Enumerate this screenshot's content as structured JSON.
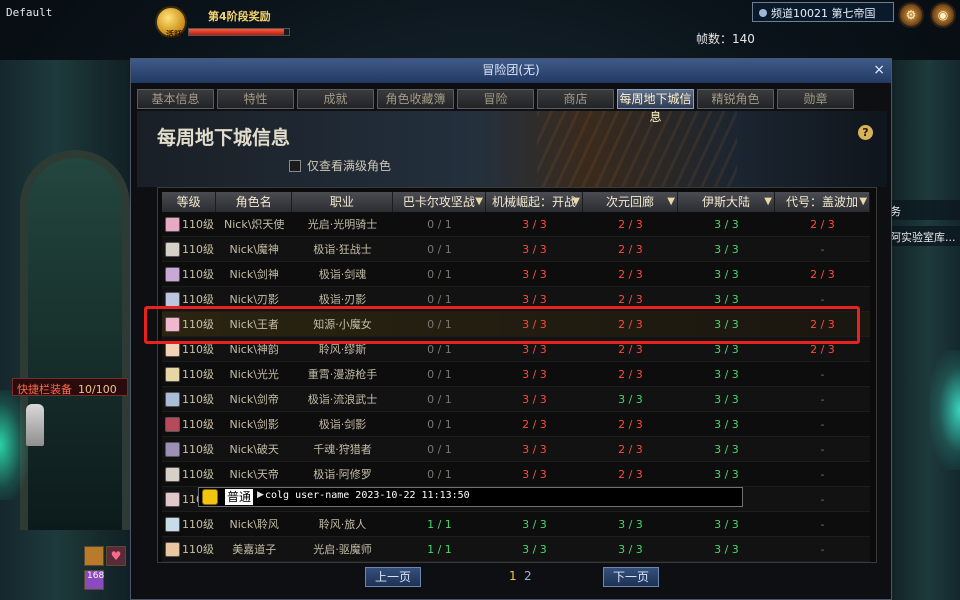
{
  "hud": {
    "top_left_label": "Default",
    "event_title": "第4阶段奖励",
    "event_badge": "活跃",
    "event_progress": 0.95,
    "fps_text": "帧数：140",
    "channel_text": "频道10021 第七帝国",
    "side_labels": [
      "务",
      "阿实验室库..."
    ],
    "quickbar_label": "快捷栏装备",
    "quickbar_count": "10/100",
    "bottom_count": "168"
  },
  "window": {
    "title": "冒险团(无)",
    "close_label": "×",
    "tabs": [
      "基本信息",
      "特性",
      "成就",
      "角色收藏簿",
      "冒险",
      "商店",
      "每周地下城信息",
      "精锐角色",
      "勋章"
    ],
    "active_tab": 6,
    "page_title": "每周地下城信息",
    "help_label": "?",
    "filter_label": "仅查看满级角色"
  },
  "table": {
    "headers": [
      "等级",
      "角色名",
      "职业",
      "巴卡尔攻坚战",
      "机械崛起：开战",
      "次元回廊",
      "伊斯大陆",
      "代号：盖波加"
    ],
    "sortable": [
      false,
      false,
      false,
      true,
      true,
      true,
      true,
      true
    ],
    "rows": [
      {
        "level": "110级",
        "name": "Nick\\炽天使",
        "job": "光启·光明骑士",
        "d1": "0 / 1",
        "d2": "3 / 3",
        "d3": "2 / 3",
        "d4": "3 / 3",
        "d5": "2 / 3",
        "avatar": "#e7a9c3",
        "highlight": false
      },
      {
        "level": "110级",
        "name": "Nick\\魔神",
        "job": "极诣·狂战士",
        "d1": "0 / 1",
        "d2": "3 / 3",
        "d3": "2 / 3",
        "d4": "3 / 3",
        "d5": "-",
        "avatar": "#d6d0c8",
        "highlight": false
      },
      {
        "level": "110级",
        "name": "Nick\\剑神",
        "job": "极诣·剑魂",
        "d1": "0 / 1",
        "d2": "3 / 3",
        "d3": "2 / 3",
        "d4": "3 / 3",
        "d5": "2 / 3",
        "avatar": "#c9a8d8",
        "highlight": false
      },
      {
        "level": "110级",
        "name": "Nick\\刃影",
        "job": "极诣·刃影",
        "d1": "0 / 1",
        "d2": "3 / 3",
        "d3": "2 / 3",
        "d4": "3 / 3",
        "d5": "-",
        "avatar": "#bcc6e0",
        "highlight": false
      },
      {
        "level": "110级",
        "name": "Nick\\王者",
        "job": "知源·小魔女",
        "d1": "0 / 1",
        "d2": "3 / 3",
        "d3": "2 / 3",
        "d4": "3 / 3",
        "d5": "2 / 3",
        "avatar": "#f0b7cf",
        "highlight": true
      },
      {
        "level": "110级",
        "name": "Nick\\神韵",
        "job": "聆风·缪斯",
        "d1": "0 / 1",
        "d2": "3 / 3",
        "d3": "2 / 3",
        "d4": "3 / 3",
        "d5": "2 / 3",
        "avatar": "#f3d2b5",
        "highlight": false
      },
      {
        "level": "110级",
        "name": "Nick\\光光",
        "job": "重霄·漫游枪手",
        "d1": "0 / 1",
        "d2": "3 / 3",
        "d3": "2 / 3",
        "d4": "3 / 3",
        "d5": "-",
        "avatar": "#e6d6a4",
        "highlight": false
      },
      {
        "level": "110级",
        "name": "Nick\\剑帝",
        "job": "极诣·流浪武士",
        "d1": "0 / 1",
        "d2": "3 / 3",
        "d3": "3 / 3",
        "d4": "3 / 3",
        "d5": "-",
        "avatar": "#a9bed6",
        "highlight": false
      },
      {
        "level": "110级",
        "name": "Nick\\剑影",
        "job": "极诣·剑影",
        "d1": "0 / 1",
        "d2": "2 / 3",
        "d3": "2 / 3",
        "d4": "3 / 3",
        "d5": "-",
        "avatar": "#b74a5a",
        "highlight": false
      },
      {
        "level": "110级",
        "name": "Nick\\破天",
        "job": "千魂·狩猎者",
        "d1": "0 / 1",
        "d2": "3 / 3",
        "d3": "2 / 3",
        "d4": "3 / 3",
        "d5": "-",
        "avatar": "#9e8fb6",
        "highlight": false
      },
      {
        "level": "110级",
        "name": "Nick\\天帝",
        "job": "极诣·阿修罗",
        "d1": "0 / 1",
        "d2": "3 / 3",
        "d3": "2 / 3",
        "d4": "3 / 3",
        "d5": "-",
        "avatar": "#d8cfc6",
        "highlight": false
      },
      {
        "level": "110级",
        "name": "",
        "job": "",
        "d1": "",
        "d2": "",
        "d3": "",
        "d4": "",
        "d5": "-",
        "avatar": "#e2c8c8",
        "highlight": false
      },
      {
        "level": "110级",
        "name": "Nick\\聆风",
        "job": "聆风·旅人",
        "d1": "1 / 1",
        "d2": "3 / 3",
        "d3": "3 / 3",
        "d4": "3 / 3",
        "d5": "-",
        "avatar": "#c7dbe8",
        "highlight": false
      },
      {
        "level": "110级",
        "name": "美嘉道子",
        "job": "光启·驱魔师",
        "d1": "1 / 1",
        "d2": "3 / 3",
        "d3": "3 / 3",
        "d4": "3 / 3",
        "d5": "-",
        "avatar": "#e9c7a2",
        "highlight": false
      }
    ]
  },
  "chat": {
    "channel_tag": "普通",
    "message": "colg user-name 2023-10-22 11:13:50"
  },
  "pager": {
    "prev_label": "上一页",
    "next_label": "下一页",
    "pages": [
      "1",
      "2"
    ],
    "current": "1"
  },
  "colors": {
    "accent_blue": "#3f5a8a",
    "completed_green": "#48d86a",
    "partial_red": "#ff4a3a",
    "highlight_outline": "#e8231f"
  }
}
